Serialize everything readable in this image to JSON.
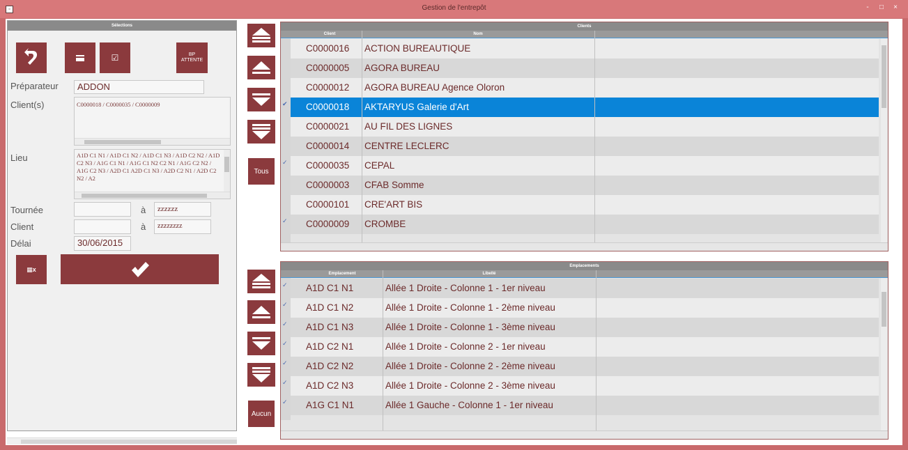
{
  "window": {
    "title": "Gestion de l'entrepôt",
    "icon": "app-icon",
    "controls": [
      "-",
      "□",
      "×"
    ]
  },
  "left": {
    "header": "Sélections",
    "buttons": {
      "back_icon": "undo-icon",
      "card_icon": "card-icon",
      "check_icon": "checkbox-icon",
      "bp_line1": "BP",
      "bp_line2": "ATTENTE"
    },
    "preparateur_label": "Préparateur",
    "preparateur_value": "ADDON",
    "clients_label": "Client(s)",
    "clients_value": "C0000018 / C0000035 / C0000009",
    "lieu_label": "Lieu",
    "lieu_value": "A1D C1 N1 / A1D C1 N2 / A1D C1 N3 / A1D C2 N2 / A1D C2 N3 / A1G C1 N1 / A1G C1 N2 C2 N1 / A1G C2 N2 / A1G C2 N3 / A2D C1 A2D C1 N3 / A2D C2 N1 / A2D C2 N2 / A2",
    "tournee_label": "Tournée",
    "tournee_from": "",
    "a_label": "à",
    "tournee_to": "zzzzzz",
    "client_label": "Client",
    "client_from": "",
    "client_to": "zzzzzzzz",
    "delai_label": "Délai",
    "delai_value": "30/06/2015",
    "excel_icon": "excel-icon",
    "validate_icon": "checkmark-icon"
  },
  "clients_grid": {
    "title": "Clients",
    "col_client": "Client",
    "col_nom": "Nom",
    "all_button": "Tous",
    "rows": [
      {
        "code": "C0000016",
        "nom": "ACTION BUREAUTIQUE",
        "mark": ""
      },
      {
        "code": "C0000005",
        "nom": "AGORA BUREAU",
        "mark": ""
      },
      {
        "code": "C0000012",
        "nom": "AGORA BUREAU Agence Oloron",
        "mark": ""
      },
      {
        "code": "C0000018",
        "nom": "AKTARYUS Galerie d'Art",
        "mark": "✔"
      },
      {
        "code": "C0000021",
        "nom": "AU FIL DES LIGNES",
        "mark": ""
      },
      {
        "code": "C0000014",
        "nom": "CENTRE LECLERC",
        "mark": ""
      },
      {
        "code": "C0000035",
        "nom": "CEPAL",
        "mark": "✓"
      },
      {
        "code": "C0000003",
        "nom": "CFAB Somme",
        "mark": ""
      },
      {
        "code": "C0000101",
        "nom": "CRE'ART BIS",
        "mark": ""
      },
      {
        "code": "C0000009",
        "nom": "CROMBE",
        "mark": "✓"
      }
    ]
  },
  "emplacements_grid": {
    "title": "Emplacements",
    "col_emp": "Emplacement",
    "col_lib": "Libellé",
    "none_button": "Aucun",
    "rows": [
      {
        "code": "A1D C1 N1",
        "lib": "Allée 1 Droite - Colonne 1 - 1er niveau"
      },
      {
        "code": "A1D C1 N2",
        "lib": "Allée 1 Droite - Colonne 1 - 2ème niveau"
      },
      {
        "code": "A1D C1 N3",
        "lib": "Allée 1 Droite - Colonne 1 - 3ème niveau"
      },
      {
        "code": "A1D C2 N1",
        "lib": "Allée 1 Droite - Colonne 2 - 1er niveau"
      },
      {
        "code": "A1D C2 N2",
        "lib": "Allée 1 Droite - Colonne 2 - 2ème niveau"
      },
      {
        "code": "A1D C2 N3",
        "lib": "Allée 1 Droite - Colonne 2 - 3ème niveau"
      },
      {
        "code": "A1G C1 N1",
        "lib": "Allée 1 Gauche - Colonne 1 - 1er niveau"
      }
    ]
  }
}
